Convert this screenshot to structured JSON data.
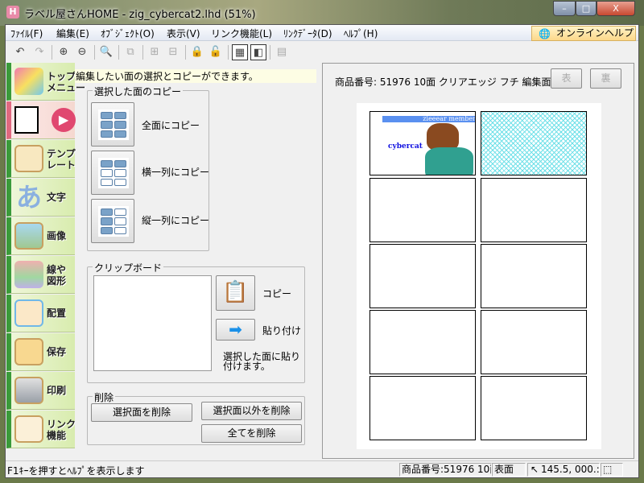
{
  "window": {
    "title": "ラベル屋さんHOME - zig_cybercat2.lhd (51%)",
    "app_icon": "H",
    "minimize": "–",
    "maximize": "□",
    "close": "X"
  },
  "menu": [
    "ﾌｧｲﾙ(F)",
    "編集(E)",
    "ｵﾌﾞｼﾞｪｸﾄ(O)",
    "表示(V)",
    "リンク機能(L)",
    "ﾘﾝｸﾃﾞｰﾀ(D)",
    "ﾍﾙﾌﾟ(H)"
  ],
  "online_help": "オンラインヘルプ",
  "sidebar": [
    {
      "label": "トップ\nメニュー",
      "icon": "home-icon"
    },
    {
      "label": "",
      "icon": "select-face-icon"
    },
    {
      "label": "テンプ\nレート",
      "icon": "template-icon"
    },
    {
      "label": "文字",
      "icon": "text-icon"
    },
    {
      "label": "画像",
      "icon": "image-icon"
    },
    {
      "label": "線や\n図形",
      "icon": "shapes-icon"
    },
    {
      "label": "配置",
      "icon": "layout-icon"
    },
    {
      "label": "保存",
      "icon": "save-icon"
    },
    {
      "label": "印刷",
      "icon": "print-icon"
    },
    {
      "label": "リンク\n機能",
      "icon": "link-icon"
    }
  ],
  "hint": "編集したい面の選択とコピーができます。",
  "copy_group": {
    "title": "選択した面のコピー",
    "all": "全面にコピー",
    "row": "横一列にコピー",
    "col": "縦一列にコピー"
  },
  "clipboard": {
    "title": "クリップボード",
    "copy": "コピー",
    "paste": "貼り付け",
    "note": "選択した面に貼り付けます。"
  },
  "delete": {
    "title": "削除",
    "selected": "選択面を削除",
    "others": "選択面以外を削除",
    "all": "全てを削除"
  },
  "product": {
    "info": "商品番号:  51976 10面 クリアエッジ フチ  編集面",
    "front": "表",
    "back": "裏"
  },
  "label_preview": {
    "banner": "zieeear member",
    "name": "cybercat"
  },
  "status": {
    "help": "F1ｷｰを押すとﾍﾙﾌﾟを表示します",
    "product": "商品番号:51976 10面",
    "side": "表面",
    "coords": "145.5, 000.:"
  }
}
